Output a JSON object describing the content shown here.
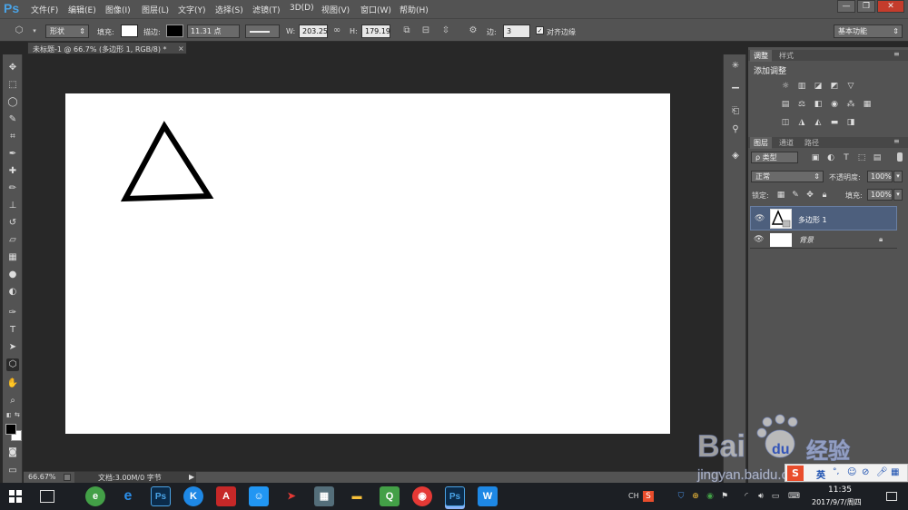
{
  "app": {
    "logo": "Ps"
  },
  "menubar": {
    "items": [
      "文件(F)",
      "编辑(E)",
      "图像(I)",
      "图层(L)",
      "文字(Y)",
      "选择(S)",
      "滤镜(T)",
      "3D(D)",
      "视图(V)",
      "窗口(W)",
      "帮助(H)"
    ],
    "window_controls": [
      "—",
      "❐",
      "✕"
    ]
  },
  "options_bar": {
    "mode_value": "形状",
    "fill_label": "填充:",
    "stroke_label": "描边:",
    "stroke_width": "11.31 点",
    "w_label": "W:",
    "w_value": "203.25",
    "h_label": "H:",
    "h_value": "179.19",
    "sides_label": "边:",
    "sides_value": "3",
    "align_edges_label": "对齐边缘",
    "align_edges_checked": true,
    "workspace": "基本功能"
  },
  "document": {
    "tab_title": "未标题-1 @ 66.7% (多边形 1, RGB/8) *",
    "close": "×"
  },
  "statusbar": {
    "zoom": "66.67%",
    "doc_info": "文档:3.00M/0 字节"
  },
  "adjustments_panel": {
    "tabs": [
      "调整",
      "样式"
    ],
    "title": "添加调整"
  },
  "layers_panel": {
    "tabs": [
      "图层",
      "通道",
      "路径"
    ],
    "filter_kind": "ρ 类型",
    "blend_mode": "正常",
    "opacity_label": "不透明度:",
    "opacity_value": "100%",
    "lock_label": "锁定:",
    "fill_label": "填充:",
    "fill_value": "100%",
    "layers": [
      {
        "name": "多边形 1",
        "selected": true
      },
      {
        "name": "背景",
        "selected": false,
        "locked": true
      }
    ]
  },
  "taskbar": {
    "ime_lang": "CH",
    "ime_mode": "英",
    "time": "11:35",
    "date": "2017/9/7/周四"
  },
  "watermark": {
    "brand": "Baidu",
    "brand_cn": "经验",
    "url": "jingyan.baidu.com"
  },
  "colors": {
    "accent": "#4aa3e6",
    "panel": "#535353",
    "workspace": "#282828",
    "selected_layer": "#4d5f7d"
  }
}
